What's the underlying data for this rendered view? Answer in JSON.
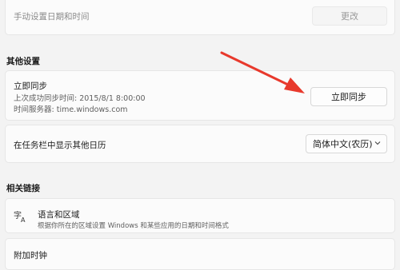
{
  "manual_time": {
    "label": "手动设置日期和时间",
    "button": "更改"
  },
  "other_settings": {
    "heading": "其他设置",
    "sync": {
      "title": "立即同步",
      "last_sync": "上次成功同步时间: 2015/8/1 8:00:00",
      "server": "时间服务器: time.windows.com",
      "button": "立即同步"
    },
    "calendar": {
      "label": "在任务栏中显示其他日历",
      "selected": "简体中文(农历)"
    }
  },
  "related_links": {
    "heading": "相关链接",
    "language_region": {
      "title": "语言和区域",
      "description": "根据你所在的区域设置 Windows 和某些应用的日期和时间格式"
    },
    "additional_clocks": {
      "title": "附加时钟"
    }
  },
  "icons": {
    "language": "language-region-icon",
    "dropdown": "chevron-down-icon"
  },
  "colors": {
    "annotation_arrow": "#e8392c"
  }
}
